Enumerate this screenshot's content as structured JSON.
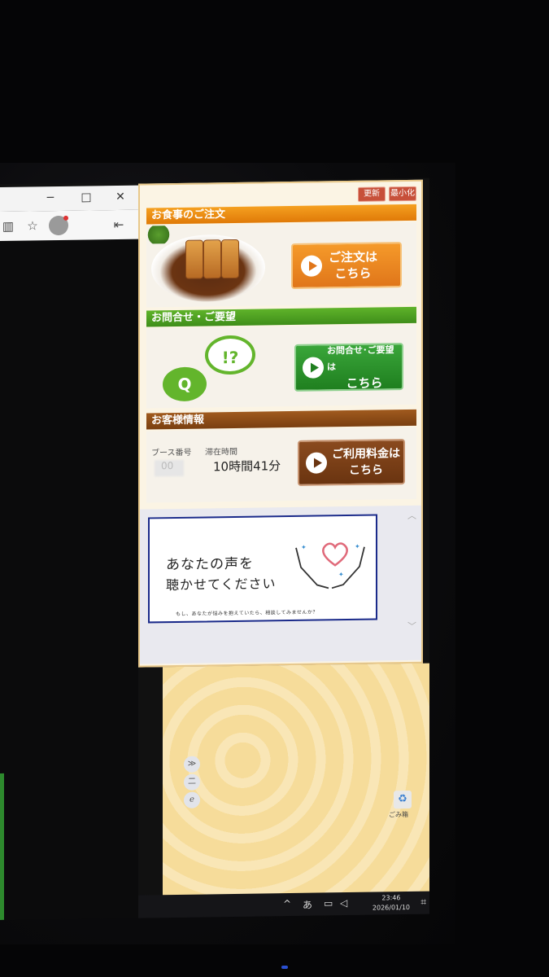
{
  "browser": {
    "window_controls": {
      "minimize": "─",
      "maximize": "□",
      "close": "✕"
    },
    "toolbar_icons": [
      "favorites-icon",
      "profile-icon",
      "sidebar-icon"
    ]
  },
  "panel": {
    "top_buttons": {
      "refresh": "更新",
      "minimize": "最小化"
    },
    "order": {
      "header": "お食事のご注文",
      "button_line1": "ご注文は",
      "button_line2": "こちら"
    },
    "inquiry": {
      "header": "お問合せ・ご要望",
      "q_glyph": "Q",
      "ex_glyph": "!?",
      "button_line1": "お問合せ･ご要望は",
      "button_line2": "こちら"
    },
    "customer": {
      "header": "お客様情報",
      "booth_label": "ブース番号",
      "booth_value": "00",
      "stay_label": "滞在時間",
      "stay_value": "10時間41分",
      "button_line1": "ご利用料金は",
      "button_line2": "こちら"
    },
    "banner": {
      "title_line1": "あなたの声を",
      "title_line2": "聴かせてください",
      "subtitle": "もし、あなたが悩みを抱えていたら、相談してみませんか？",
      "scroll_up": "︿",
      "scroll_down": "﹀"
    }
  },
  "desktop": {
    "recycle_bin_label": "ごみ箱",
    "side_toggle": [
      "≫",
      "二",
      "ℯ"
    ]
  },
  "taskbar": {
    "tray_chevron": "^",
    "ime": "あ",
    "time": "23:46",
    "date": "2026/01/10"
  },
  "colors": {
    "order_accent": "#e0761a",
    "inquiry_accent": "#3f8e1a",
    "customer_accent": "#7a3f10",
    "banner_border": "#1a2a8a"
  }
}
